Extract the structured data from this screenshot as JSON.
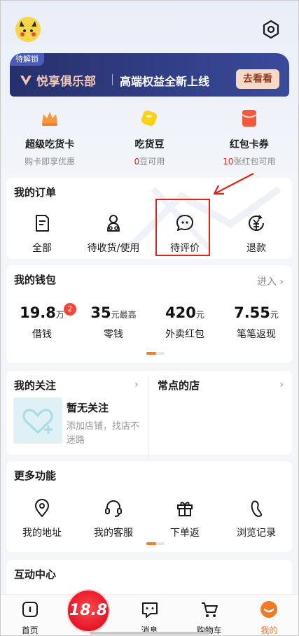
{
  "club": {
    "tag": "待解锁",
    "name": "悦享俱乐部",
    "desc": "高端权益全新上线",
    "cta": "去看看"
  },
  "perks": [
    {
      "icon": "crown-icon",
      "title": "超级吃货卡",
      "sub_prefix": "",
      "sub": "购卡即享优惠"
    },
    {
      "icon": "bean-icon",
      "title": "吃货豆",
      "sub_prefix": "0",
      "sub": "豆可用"
    },
    {
      "icon": "red-packet-icon",
      "title": "红包卡券",
      "sub_prefix": "10",
      "sub": "张红包可用"
    }
  ],
  "orders": {
    "title": "我的订单",
    "items": [
      {
        "icon": "order-list-icon",
        "label": "全部"
      },
      {
        "icon": "delivery-person-icon",
        "label": "待收货/使用"
      },
      {
        "icon": "chat-bubble-icon",
        "label": "待评价"
      },
      {
        "icon": "refund-icon",
        "label": "退款"
      }
    ]
  },
  "wallet": {
    "title": "我的钱包",
    "enter": "进入",
    "badge": "2",
    "items": [
      {
        "value": "19.8",
        "unit": "万",
        "label": "借钱"
      },
      {
        "value": "35",
        "unit": "元最高",
        "label": "零钱"
      },
      {
        "value": "420",
        "unit": "元",
        "label": "外卖红包"
      },
      {
        "value": "7.55",
        "unit": "元",
        "label": "笔笔返现"
      }
    ]
  },
  "follow": {
    "title": "我的关注",
    "empty_title": "暂无关注",
    "empty_desc": "添加店铺，找店不迷路",
    "stores_title": "常点的店"
  },
  "more": {
    "title": "更多功能",
    "items": [
      {
        "icon": "location-pin-icon",
        "label": "我的地址"
      },
      {
        "icon": "headset-icon",
        "label": "我的客服"
      },
      {
        "icon": "gift-icon",
        "label": "下单返"
      },
      {
        "icon": "footprint-icon",
        "label": "浏览记录"
      }
    ]
  },
  "interact": {
    "title": "互动中心"
  },
  "nav": {
    "items": [
      {
        "icon": "home-icon",
        "label": "首页"
      },
      {
        "icon": "promo-icon",
        "label": ""
      },
      {
        "icon": "message-icon",
        "label": "消息"
      },
      {
        "icon": "cart-icon",
        "label": "购物车"
      },
      {
        "icon": "profile-icon",
        "label": "我的"
      }
    ],
    "promo": "18.8",
    "active_color": "#f07a26"
  },
  "colors": {
    "accent": "#f07a26",
    "red": "#e0241b",
    "highlight": "#e2231a"
  }
}
